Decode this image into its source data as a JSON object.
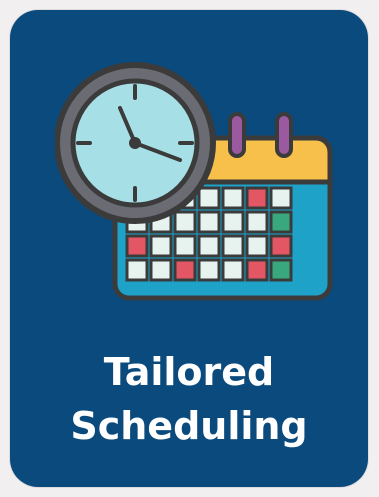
{
  "card": {
    "title_line1": "Tailored",
    "title_line2": "Scheduling",
    "background": "#0b4a7c",
    "icon": "clock-calendar-icon"
  }
}
